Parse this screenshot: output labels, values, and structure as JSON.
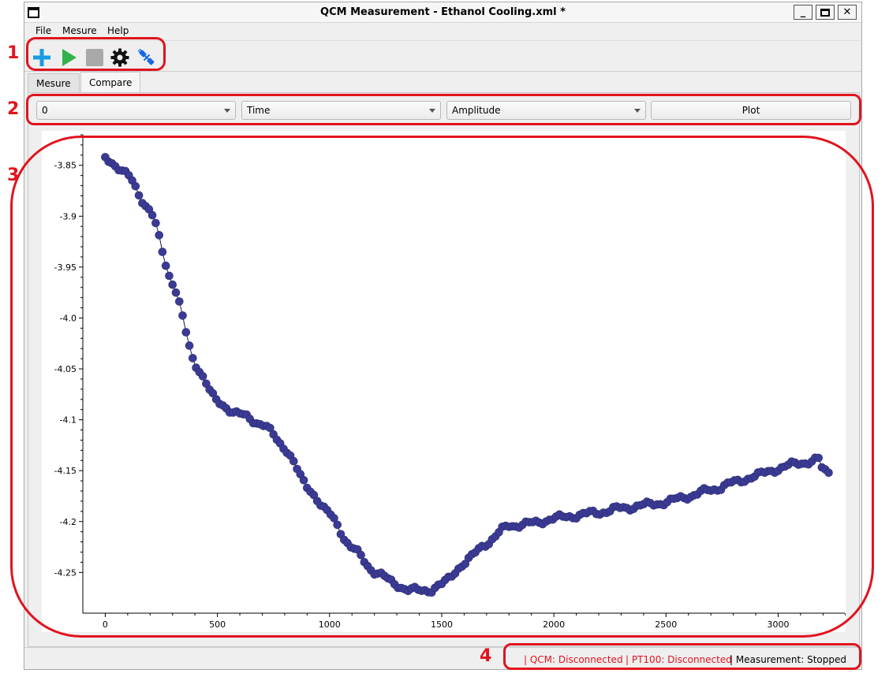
{
  "window": {
    "title": "QCM Measurement - Ethanol Cooling.xml *"
  },
  "menu": {
    "items": [
      "File",
      "Mesure",
      "Help"
    ]
  },
  "toolbar": {
    "tools": [
      {
        "name": "add-icon",
        "color": "#1a9be6"
      },
      {
        "name": "play-icon",
        "color": "#34b24a"
      },
      {
        "name": "stop-icon",
        "color": "#a9a9a9"
      },
      {
        "name": "gear-icon",
        "color": "#111111"
      },
      {
        "name": "connect-icon",
        "color": "#1468e8"
      }
    ]
  },
  "tabs": [
    {
      "label": "Mesure",
      "active": false
    },
    {
      "label": "Compare",
      "active": true
    }
  ],
  "controls": {
    "dataset_select": "0",
    "x_select": "Time",
    "y_select": "Amplitude",
    "plot_label": "Plot"
  },
  "status": {
    "qcm": "| QCM: Disconnected",
    "pt100": "| PT100: Disconnected",
    "measurement": "| Measurement: Stopped",
    "error_color": "#e0141e"
  },
  "annotations": [
    "1",
    "2",
    "3",
    "4"
  ],
  "chart_data": {
    "type": "line",
    "marker": "circle",
    "marker_color": "#3b3b95",
    "line_color": "#1c1c4a",
    "x": [
      0,
      100,
      200,
      300,
      400,
      500,
      600,
      700,
      800,
      900,
      1000,
      1100,
      1200,
      1300,
      1350,
      1400,
      1450,
      1500,
      1600,
      1700,
      1800,
      1900,
      2000,
      2100,
      2200,
      2300,
      2400,
      2500,
      2600,
      2700,
      2800,
      2900,
      3000,
      3100,
      3150,
      3180,
      3200,
      3230
    ],
    "y": [
      -3.842,
      -3.86,
      -3.895,
      -3.965,
      -4.045,
      -4.083,
      -4.095,
      -4.104,
      -4.127,
      -4.166,
      -4.193,
      -4.226,
      -4.249,
      -4.262,
      -4.267,
      -4.268,
      -4.267,
      -4.262,
      -4.241,
      -4.221,
      -4.204,
      -4.202,
      -4.197,
      -4.194,
      -4.191,
      -4.187,
      -4.184,
      -4.181,
      -4.175,
      -4.169,
      -4.162,
      -4.155,
      -4.148,
      -4.142,
      -4.141,
      -4.139,
      -4.15,
      -4.151
    ],
    "xlim": [
      -100,
      3350
    ],
    "ylim": [
      -4.29,
      -3.82
    ],
    "xticks": [
      0,
      500,
      1000,
      1500,
      2000,
      2500,
      3000
    ],
    "xtick_labels": [
      "0",
      "500",
      "1000",
      "1500",
      "2000",
      "2500",
      "3000"
    ],
    "yticks": [
      -3.85,
      -3.9,
      -3.95,
      -4.0,
      -4.05,
      -4.1,
      -4.15,
      -4.2,
      -4.25
    ],
    "ytick_labels": [
      "-3.85",
      "-3.9",
      "-3.95",
      "-4.0",
      "-4.05",
      "-4.1",
      "-4.15",
      "-4.2",
      "-4.25"
    ],
    "grid": false
  }
}
